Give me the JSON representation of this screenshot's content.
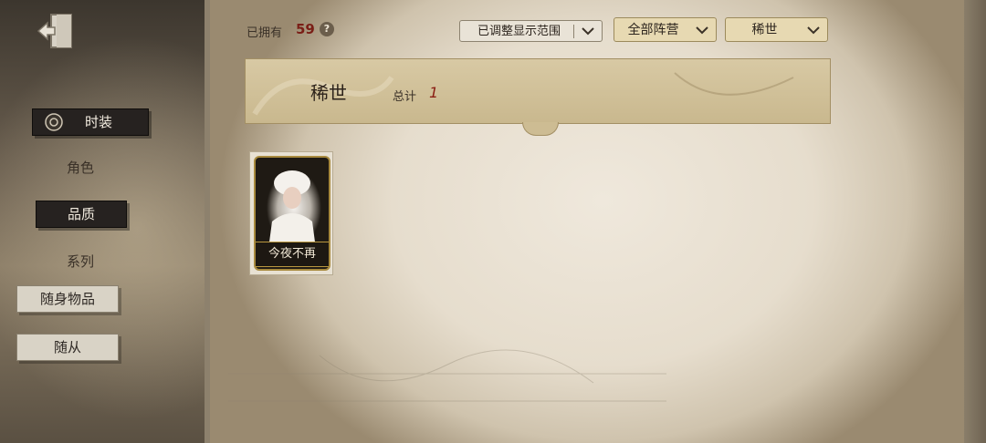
{
  "sidebar": {
    "items": [
      {
        "label": "时装",
        "state": "selected"
      },
      {
        "label": "角色",
        "state": "plain"
      },
      {
        "label": "品质",
        "state": "selected"
      },
      {
        "label": "系列",
        "state": "plain"
      },
      {
        "label": "随身物品",
        "state": "tab"
      },
      {
        "label": "随从",
        "state": "tab"
      }
    ],
    "exit_icon": "exit-door-icon"
  },
  "header": {
    "owned_label": "已拥有",
    "owned_count": "59",
    "help_symbol": "?",
    "filters": {
      "range_label": "已调整显示范围",
      "faction_label": "全部阵营",
      "quality_label": "稀世"
    }
  },
  "banner": {
    "title": "稀世",
    "total_label": "总计",
    "total_value": "1"
  },
  "cards": [
    {
      "name": "今夜不再"
    }
  ],
  "colors": {
    "accent_red": "#8a1d13",
    "gold_frame": "#a88a3e",
    "dark_button": "#262220"
  }
}
